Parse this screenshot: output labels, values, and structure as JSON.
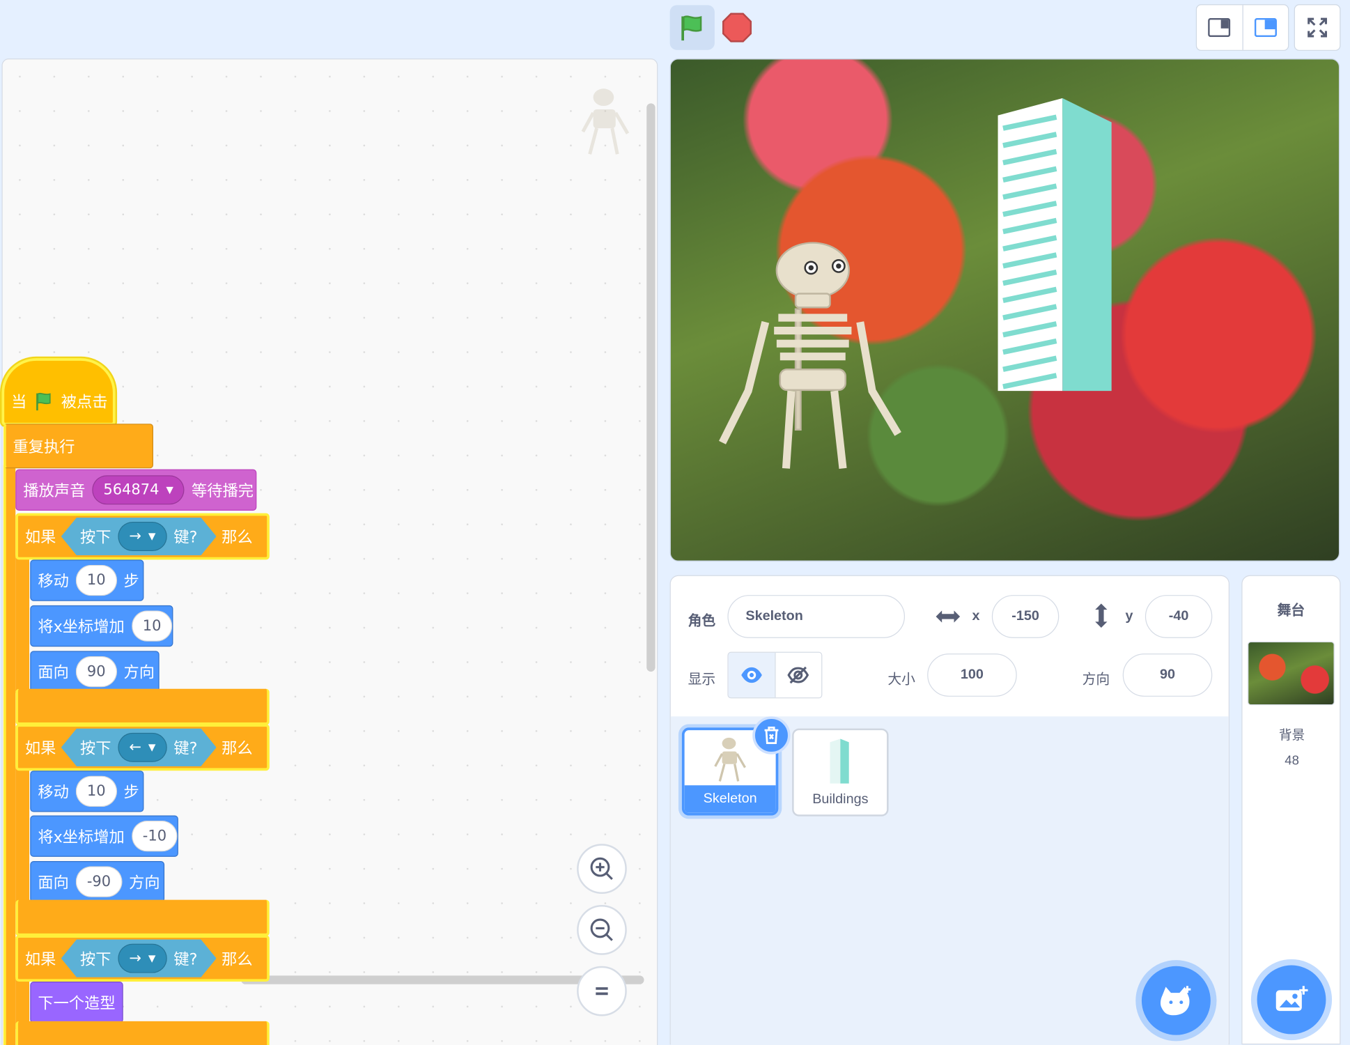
{
  "controls": {
    "green_flag_icon": "green-flag-icon",
    "stop_icon": "stop-icon"
  },
  "script": {
    "hat": {
      "when": "当",
      "clicked": "被点击"
    },
    "forever": "重复执行",
    "play_sound": {
      "label": "播放声音",
      "sound": "564874",
      "suffix": "等待播完"
    },
    "if1": {
      "if": "如果",
      "key_pressed": "按下",
      "key": "→",
      "key_suffix": "键?",
      "then": "那么"
    },
    "move1": {
      "label": "移动",
      "steps": "10",
      "unit": "步"
    },
    "changex1": {
      "label": "将x坐标增加",
      "value": "10"
    },
    "point1": {
      "label": "面向",
      "value": "90",
      "unit": "方向"
    },
    "if2": {
      "if": "如果",
      "key_pressed": "按下",
      "key": "←",
      "key_suffix": "键?",
      "then": "那么"
    },
    "move2": {
      "label": "移动",
      "steps": "10",
      "unit": "步"
    },
    "changex2": {
      "label": "将x坐标增加",
      "value": "-10"
    },
    "point2": {
      "label": "面向",
      "value": "-90",
      "unit": "方向"
    },
    "if3": {
      "if": "如果",
      "key_pressed": "按下",
      "key": "→",
      "key_suffix": "键?",
      "then": "那么"
    },
    "next_costume": "下一个造型"
  },
  "sprite_info": {
    "sprite_label": "角色",
    "sprite_name": "Skeleton",
    "x_label": "x",
    "x": "-150",
    "y_label": "y",
    "y": "-40",
    "show_label": "显示",
    "size_label": "大小",
    "size": "100",
    "direction_label": "方向",
    "direction": "90"
  },
  "sprites": [
    {
      "name": "Skeleton",
      "selected": true
    },
    {
      "name": "Buildings",
      "selected": false
    }
  ],
  "stage_panel": {
    "title": "舞台",
    "backdrops_label": "背景",
    "backdrop_count": "48"
  },
  "colors": {
    "accent": "#4c97ff",
    "events": "#ffbf00",
    "control": "#ffab19",
    "sound": "#cf63cf",
    "motion": "#4c97ff",
    "looks": "#9966ff",
    "sensing": "#5cb1d6"
  }
}
